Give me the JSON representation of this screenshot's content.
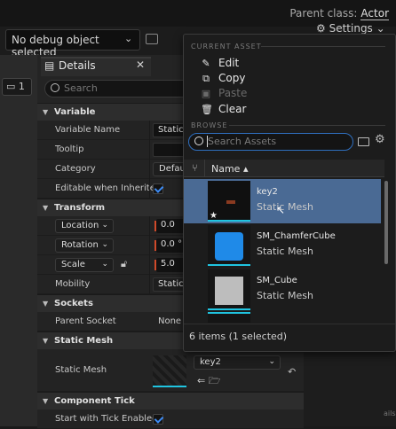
{
  "header": {
    "parent_class_label": "Parent class:",
    "parent_class_value": "Actor"
  },
  "toolbar": {
    "debug_object": "No debug object selected",
    "settings_label": "Settings"
  },
  "viewport": {
    "camera_label": "1"
  },
  "details": {
    "tab_title": "Details",
    "search_placeholder": "Search",
    "sections": {
      "variable": "Variable",
      "transform": "Transform",
      "sockets": "Sockets",
      "static_mesh": "Static Mesh",
      "component_tick": "Component Tick"
    },
    "rows": {
      "variable_name": "Variable Name",
      "variable_name_value": "StaticM",
      "tooltip": "Tooltip",
      "category": "Category",
      "category_value": "Defau",
      "editable_when_inherited": "Editable when Inherited",
      "location": "Location",
      "location_x": "0.0",
      "rotation": "Rotation",
      "rotation_x": "0.0 °",
      "scale": "Scale",
      "scale_x": "5.0",
      "mobility": "Mobility",
      "mobility_value": "Static",
      "parent_socket": "Parent Socket",
      "parent_socket_value": "None",
      "static_mesh": "Static Mesh",
      "static_mesh_value": "key2",
      "start_with_tick": "Start with Tick Enabled"
    },
    "partial_text": "ails."
  },
  "popup": {
    "current_asset_header": "CURRENT ASSET",
    "edit": "Edit",
    "copy": "Copy",
    "paste": "Paste",
    "clear": "Clear",
    "browse_header": "BROWSE",
    "search_placeholder": "Search Assets",
    "column_name": "Name",
    "items": [
      {
        "name": "key2",
        "type": "Static Mesh"
      },
      {
        "name": "SM_ChamferCube",
        "type": "Static Mesh"
      },
      {
        "name": "SM_Cube",
        "type": "Static Mesh"
      }
    ],
    "footer": "6 items (1 selected)"
  },
  "colors": {
    "accent": "#3d8cf5",
    "selection": "#4a6a94",
    "thumbnail_underline": "#20c4e0"
  }
}
